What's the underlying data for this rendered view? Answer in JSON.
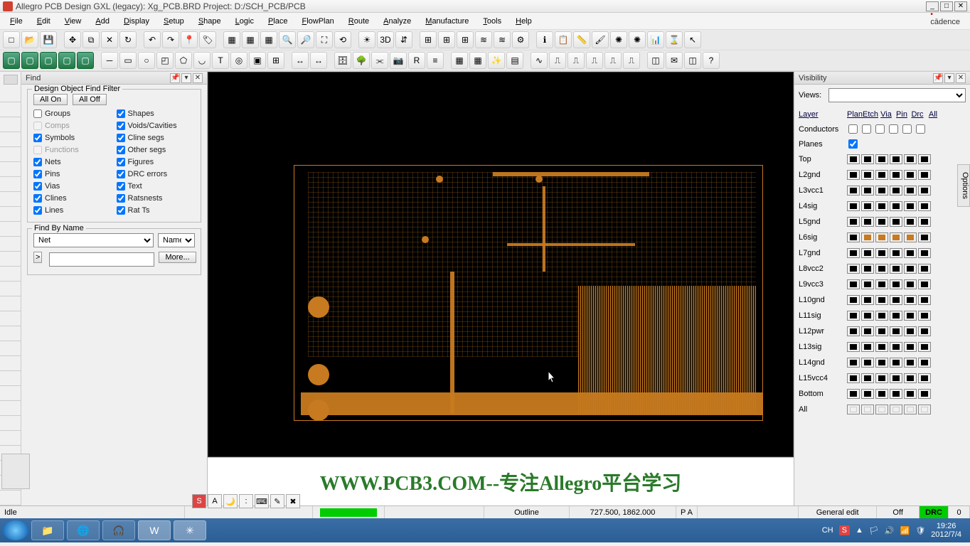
{
  "title": "Allegro PCB Design GXL (legacy): Xg_PCB.BRD   Project: D:/SCH_PCB/PCB",
  "brand": "cādence",
  "menus": [
    "File",
    "Edit",
    "View",
    "Add",
    "Display",
    "Setup",
    "Shape",
    "Logic",
    "Place",
    "FlowPlan",
    "Route",
    "Analyze",
    "Manufacture",
    "Tools",
    "Help"
  ],
  "find": {
    "title": "Find",
    "group_title": "Design Object Find Filter",
    "all_on": "All On",
    "all_off": "All Off",
    "left_filters": [
      {
        "label": "Groups",
        "checked": false,
        "disabled": false
      },
      {
        "label": "Comps",
        "checked": false,
        "disabled": true
      },
      {
        "label": "Symbols",
        "checked": true,
        "disabled": false
      },
      {
        "label": "Functions",
        "checked": false,
        "disabled": true
      },
      {
        "label": "Nets",
        "checked": true,
        "disabled": false
      },
      {
        "label": "Pins",
        "checked": true,
        "disabled": false
      },
      {
        "label": "Vias",
        "checked": true,
        "disabled": false
      },
      {
        "label": "Clines",
        "checked": true,
        "disabled": false
      },
      {
        "label": "Lines",
        "checked": true,
        "disabled": false
      }
    ],
    "right_filters": [
      {
        "label": "Shapes",
        "checked": true
      },
      {
        "label": "Voids/Cavities",
        "checked": true
      },
      {
        "label": "Cline segs",
        "checked": true
      },
      {
        "label": "Other segs",
        "checked": true
      },
      {
        "label": "Figures",
        "checked": true
      },
      {
        "label": "DRC errors",
        "checked": true
      },
      {
        "label": "Text",
        "checked": true
      },
      {
        "label": "Ratsnests",
        "checked": true
      },
      {
        "label": "Rat Ts",
        "checked": true
      }
    ],
    "find_by_name_title": "Find By Name",
    "type_select": "Net",
    "name_select": "Name",
    "more_btn": "More...",
    "expand_btn": ">"
  },
  "visibility": {
    "title": "Visibility",
    "views_label": "Views:",
    "views_value": "",
    "layer_label": "Layer",
    "cols": [
      "Plan",
      "Etch",
      "Via",
      "Pin",
      "Drc",
      "All"
    ],
    "conductors": "Conductors",
    "planes": "Planes",
    "planes_checked": true,
    "layers": [
      "Top",
      "L2gnd",
      "L3vcc1",
      "L4sig",
      "L5gnd",
      "L6sig",
      "L7gnd",
      "L8vcc2",
      "L9vcc3",
      "L10gnd",
      "L11sig",
      "L12pwr",
      "L13sig",
      "L14gnd",
      "L15vcc4",
      "Bottom",
      "All"
    ],
    "l6_highlight": true
  },
  "options_tab": "Options",
  "banner": "WWW.PCB3.COM--专注Allegro平台学习",
  "status": {
    "idle": "Idle",
    "outline": "Outline",
    "coords": "727.500, 1862.000",
    "pa": "P  A",
    "mode": "General edit",
    "off": "Off",
    "drc": "DRC",
    "drc_count": "0"
  },
  "ime": {
    "lang": "S",
    "buttons": [
      "A",
      "🌙",
      ":",
      "⌨",
      "✎",
      "✖"
    ]
  },
  "taskbar": {
    "lang": "CH",
    "s_badge": "S",
    "time": "19:26",
    "date": "2012/7/4"
  },
  "colors": {
    "copper": "#c77a1f",
    "board": "#000000",
    "accent": "#00cc00"
  }
}
